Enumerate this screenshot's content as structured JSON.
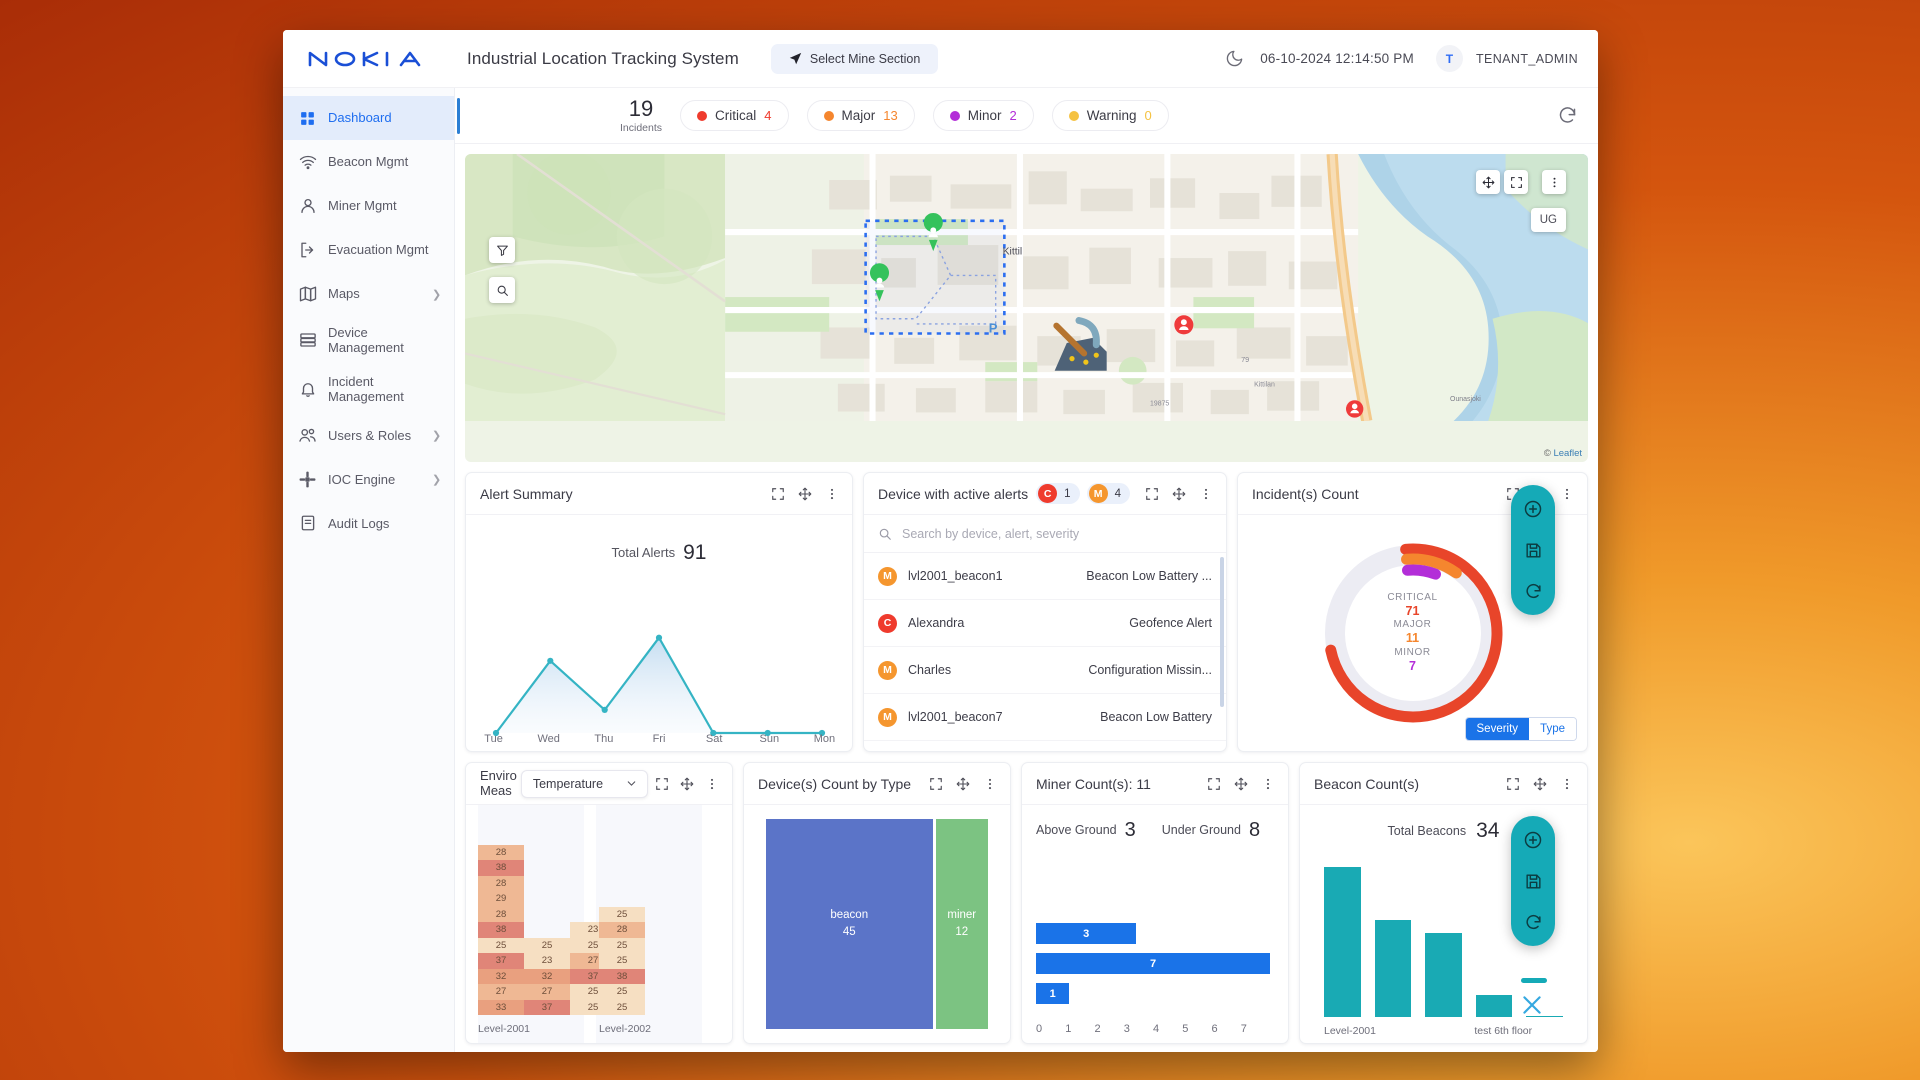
{
  "header": {
    "logo_alt": "NOKIA",
    "app_title": "Industrial Location Tracking System",
    "select_mine_label": "Select Mine Section",
    "datetime": "06-10-2024 12:14:50 PM",
    "avatar_initial": "T",
    "username": "TENANT_ADMIN"
  },
  "sidebar": {
    "items": [
      {
        "label": "Dashboard",
        "icon": "grid-icon",
        "active": true,
        "chevron": false
      },
      {
        "label": "Beacon Mgmt",
        "icon": "wifi-icon",
        "active": false,
        "chevron": false
      },
      {
        "label": "Miner Mgmt",
        "icon": "user-icon",
        "active": false,
        "chevron": false
      },
      {
        "label": "Evacuation Mgmt",
        "icon": "exit-icon",
        "active": false,
        "chevron": false
      },
      {
        "label": "Maps",
        "icon": "map-icon",
        "active": false,
        "chevron": true
      },
      {
        "label": "Device Management",
        "icon": "server-icon",
        "active": false,
        "chevron": false
      },
      {
        "label": "Incident Management",
        "icon": "bell-icon",
        "active": false,
        "chevron": false
      },
      {
        "label": "Users & Roles",
        "icon": "users-icon",
        "active": false,
        "chevron": true
      },
      {
        "label": "IOC Engine",
        "icon": "nodes-icon",
        "active": false,
        "chevron": true
      },
      {
        "label": "Audit Logs",
        "icon": "document-icon",
        "active": false,
        "chevron": false
      }
    ]
  },
  "incidents": {
    "total": "19",
    "total_caption": "Incidents",
    "severities": [
      {
        "label": "Critical",
        "count": "4",
        "color": "#ef3b2d"
      },
      {
        "label": "Major",
        "count": "13",
        "color": "#f5862e"
      },
      {
        "label": "Minor",
        "count": "2",
        "color": "#b32ed8"
      },
      {
        "label": "Warning",
        "count": "0",
        "color": "#f5c242"
      }
    ],
    "refresh_icon": "refresh-icon"
  },
  "map": {
    "zoom_in": "+",
    "zoom_out": "−",
    "filter_icon": "filter-icon",
    "search_icon": "search-icon",
    "move_icon": "move-icon",
    "expand_icon": "expand-icon",
    "kebab_icon": "kebab-icon",
    "layer_label": "UG",
    "place_label": "Kittil",
    "attribution_prefix": "© ",
    "attribution": "Leaflet"
  },
  "alert_summary": {
    "title": "Alert Summary",
    "total_label": "Total Alerts",
    "total_value": "91",
    "tools": [
      "expand-icon",
      "move-icon",
      "kebab-icon"
    ]
  },
  "device_alerts": {
    "title": "Device with active alerts",
    "badges": [
      {
        "letter": "C",
        "count": "1",
        "color": "#ef3b2d"
      },
      {
        "letter": "M",
        "count": "4",
        "color": "#f5962e"
      }
    ],
    "search_placeholder": "Search by device, alert, severity",
    "search_value": "",
    "rows": [
      {
        "severity": "M",
        "color": "#f5962e",
        "device": "lvl2001_beacon1",
        "message": "Beacon Low Battery ..."
      },
      {
        "severity": "C",
        "color": "#ef3b2d",
        "device": "Alexandra",
        "message": "Geofence Alert"
      },
      {
        "severity": "M",
        "color": "#f5962e",
        "device": "Charles",
        "message": "Configuration Missin..."
      },
      {
        "severity": "M",
        "color": "#f5962e",
        "device": "lvl2001_beacon7",
        "message": "Beacon Low Battery"
      }
    ]
  },
  "incident_count": {
    "title": "Incident(s) Count",
    "toggle": {
      "left": "Severity",
      "right": "Type",
      "selected": "Severity"
    }
  },
  "environment": {
    "title_line1": "Enviro",
    "title_line2": "Meas",
    "select_value": "Temperature",
    "chevron_icon": "chevron-down-icon"
  },
  "device_type": {
    "title": "Device(s) Count by Type"
  },
  "miner_count": {
    "title": "Miner Count(s): 11",
    "above_label": "Above Ground",
    "above_value": "3",
    "under_label": "Under Ground",
    "under_value": "8"
  },
  "beacon_count": {
    "title": "Beacon Count(s)",
    "total_label": "Total Beacons",
    "total_value": "34"
  },
  "floating_toolbars": {
    "icons": [
      "zoom-in-icon",
      "save-icon",
      "refresh-icon"
    ],
    "close_icon": "close-icon"
  },
  "chart_data": [
    {
      "type": "area",
      "name": "alert-summary-line",
      "title": "Alert Summary",
      "categories": [
        "Tue",
        "Wed",
        "Thu",
        "Fri",
        "Sat",
        "Sun",
        "Mon"
      ],
      "values": [
        0,
        25,
        8,
        33,
        0,
        0,
        0
      ],
      "ylim": [
        0,
        36
      ],
      "grid": false,
      "legend": "none",
      "series_color": "#35b4c4",
      "annotations": [
        {
          "label": "Total Alerts",
          "value": 91
        }
      ]
    },
    {
      "type": "pie",
      "name": "incident-count-donut",
      "title": "Incident(s) Count",
      "labels": [
        "CRITICAL",
        "MAJOR",
        "MINOR"
      ],
      "values": [
        71,
        11,
        7
      ],
      "colors": [
        "#e8452a",
        "#f5862e",
        "#b32ed8"
      ],
      "donut": true,
      "track_color": "#ececf3",
      "legend": "center-labels"
    },
    {
      "type": "heatmap",
      "name": "environment-measurement-heatmap",
      "title": "Environment Measurement",
      "metric": "Temperature",
      "xlabels": [
        "Level-2001",
        "Level-2002"
      ],
      "groups": [
        {
          "x": "Level-2001",
          "columns": [
            {
              "values": [
                28,
                38,
                28,
                29,
                28,
                38,
                25,
                37,
                32,
                27,
                33
              ]
            },
            {
              "values": [
                25,
                23,
                32,
                27,
                37
              ]
            },
            {
              "values": [
                23,
                25,
                27,
                37,
                25,
                25
              ]
            }
          ]
        },
        {
          "x": "Level-2002",
          "columns": [
            {
              "values": [
                25,
                28,
                25,
                25,
                38,
                25,
                25
              ]
            }
          ]
        }
      ],
      "colorscale": [
        {
          "max": 26,
          "color": "#f6dfc2"
        },
        {
          "max": 30,
          "color": "#efb894"
        },
        {
          "max": 35,
          "color": "#e9a07f"
        },
        {
          "max": 99,
          "color": "#e08578"
        }
      ]
    },
    {
      "type": "treemap",
      "name": "device-count-by-type",
      "title": "Device(s) Count by Type",
      "labels": [
        "beacon",
        "miner"
      ],
      "values": [
        45,
        12
      ],
      "colors": [
        "#5b74c8",
        "#7cc382"
      ]
    },
    {
      "type": "bar",
      "name": "miner-counts-bar",
      "title": "Miner Count(s): 11",
      "orientation": "horizontal",
      "categories": [
        "",
        "",
        ""
      ],
      "values": [
        3,
        7,
        1
      ],
      "xlim": [
        0,
        7
      ],
      "xticks": [
        "0",
        "1",
        "2",
        "3",
        "4",
        "5",
        "6",
        "7"
      ],
      "color": "#1a73e8"
    },
    {
      "type": "bar",
      "name": "beacon-counts-bar",
      "title": "Beacon Count(s)",
      "categories": [
        "Level-2001",
        "",
        "",
        "test 6th floor",
        ""
      ],
      "values": [
        34,
        22,
        19,
        5,
        0
      ],
      "xticks": [
        "Level-2001",
        "test 6th floor"
      ],
      "color": "#19aab4",
      "annotations": [
        {
          "label": "Total Beacons",
          "value": 34
        }
      ]
    }
  ]
}
